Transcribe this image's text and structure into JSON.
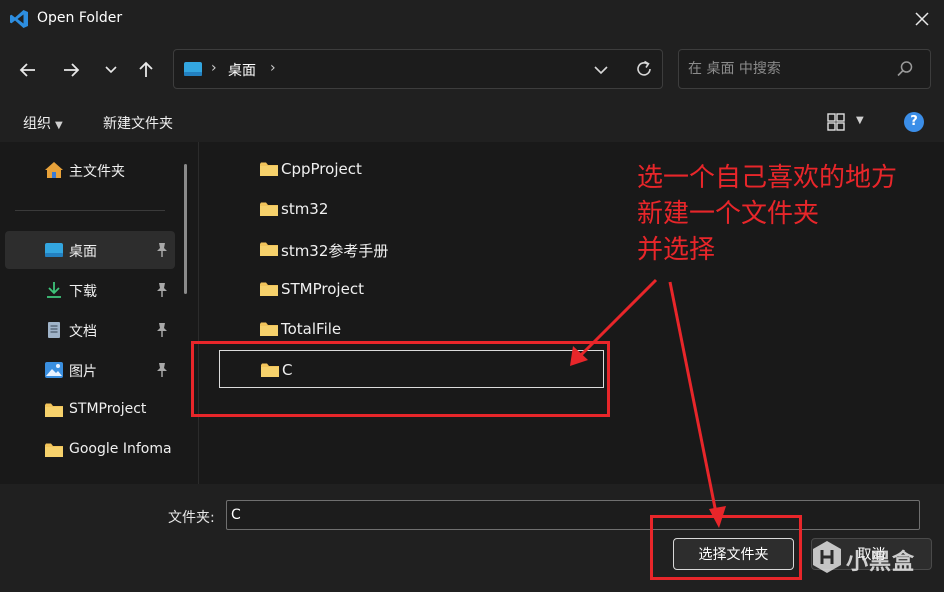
{
  "window": {
    "title": "Open Folder"
  },
  "nav": {
    "address": "桌面",
    "search_placeholder": "在 桌面 中搜索"
  },
  "toolbar": {
    "organize_label": "组织",
    "new_folder_label": "新建文件夹"
  },
  "sidebar": {
    "items": [
      {
        "label": "主文件夹",
        "icon": "home-icon",
        "pinned": false
      },
      {
        "label": "桌面",
        "icon": "desktop-folder-icon",
        "pinned": true,
        "selected": true
      },
      {
        "label": "下载",
        "icon": "download-icon",
        "pinned": true
      },
      {
        "label": "文档",
        "icon": "document-icon",
        "pinned": true
      },
      {
        "label": "图片",
        "icon": "picture-icon",
        "pinned": true
      },
      {
        "label": "STMProject",
        "icon": "folder-icon",
        "pinned": false
      },
      {
        "label": "Google Infoma",
        "icon": "folder-icon",
        "pinned": false
      }
    ]
  },
  "files": [
    {
      "name": "CppProject"
    },
    {
      "name": "stm32"
    },
    {
      "name": "stm32参考手册"
    },
    {
      "name": "STMProject"
    },
    {
      "name": "TotalFile"
    },
    {
      "name": "C",
      "editing": true
    }
  ],
  "footer": {
    "folder_label": "文件夹:",
    "folder_value": "C",
    "select_label": "选择文件夹",
    "cancel_label": "取消"
  },
  "annotation": {
    "line1": "选一个自己喜欢的地方",
    "line2": "新建一个文件夹",
    "line3": "并选择",
    "color": "#e8262a"
  },
  "watermark": {
    "text": "小黑盒"
  },
  "colors": {
    "background": "#191919",
    "chrome": "#202020",
    "folder": "#f2c45a",
    "accent": "#3b8ee8"
  }
}
